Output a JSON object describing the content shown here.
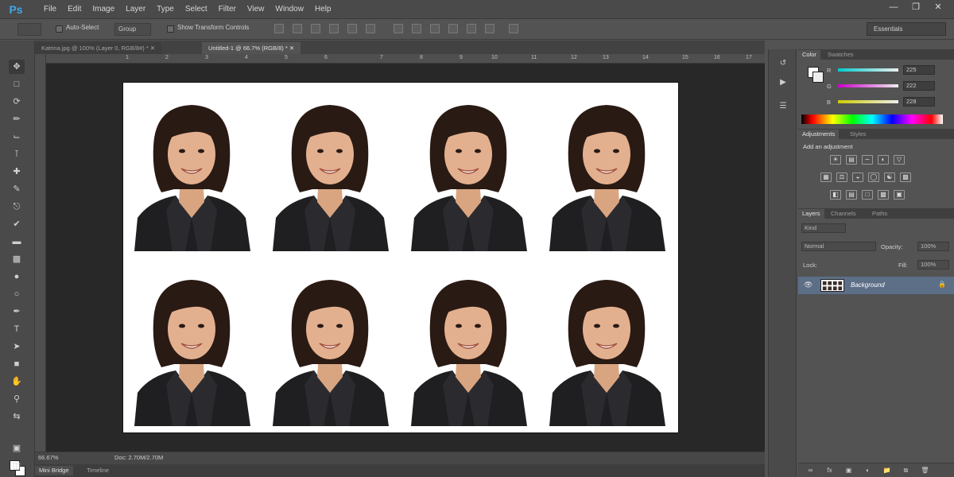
{
  "app": {
    "logo": "Ps",
    "accent": "#3fa7e8"
  },
  "menu": [
    "File",
    "Edit",
    "Image",
    "Layer",
    "Type",
    "Select",
    "Filter",
    "View",
    "Window",
    "Help"
  ],
  "window_controls": {
    "minimize": "—",
    "maximize": "❐",
    "close": "✕"
  },
  "options": {
    "auto_select_label": "Auto-Select",
    "auto_select_target": "Group",
    "show_transform_label": "Show Transform Controls",
    "workspace": "Essentials"
  },
  "tabs": [
    {
      "label": "Katrina.jpg @ 100% (Layer 0, RGB/8#) *  ✕"
    },
    {
      "label": "Untitled-1 @ 66.7% (RGB/8) *  ✕"
    }
  ],
  "ruler_numbers": [
    "1",
    "2",
    "3",
    "4",
    "5",
    "6",
    "7",
    "8",
    "9",
    "10",
    "11",
    "12",
    "13",
    "14",
    "15",
    "16",
    "17"
  ],
  "status": {
    "zoom": "66.67%",
    "doc": "Doc: 2.70M/2.70M"
  },
  "bottom_tabs": [
    "Mini Bridge",
    "Timeline"
  ],
  "color_panel": {
    "tabs": [
      "Color",
      "Swatches"
    ],
    "channels": [
      {
        "label": "R",
        "value": "225",
        "color": "#e04a4a"
      },
      {
        "label": "G",
        "value": "222",
        "color": "#3ec94a"
      },
      {
        "label": "B",
        "value": "228",
        "color": "#4a6ee0"
      }
    ]
  },
  "adjustments_panel": {
    "tabs": [
      "Adjustments",
      "Styles"
    ],
    "heading": "Add an adjustment"
  },
  "layers_panel": {
    "tabs": [
      "Layers",
      "Channels",
      "Paths"
    ],
    "kind_label": "Kind",
    "blend_mode": "Normal",
    "opacity_label": "Opacity:",
    "opacity_value": "100%",
    "lock_label": "Lock:",
    "fill_label": "Fill:",
    "fill_value": "100%",
    "layers": [
      {
        "name": "Background"
      }
    ]
  },
  "photos": {
    "count": 8,
    "rows": 2,
    "cols": 4
  }
}
